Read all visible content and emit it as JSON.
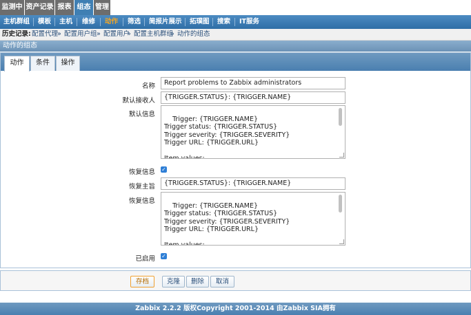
{
  "top_menu": {
    "items": [
      {
        "label": "监测中"
      },
      {
        "label": "资产记录"
      },
      {
        "label": "报表"
      },
      {
        "label": "组态"
      },
      {
        "label": "管理"
      }
    ]
  },
  "sub_menu": {
    "items": [
      {
        "label": "主机群组"
      },
      {
        "label": "模板"
      },
      {
        "label": "主机"
      },
      {
        "label": "维修"
      },
      {
        "label": "动作"
      },
      {
        "label": "筛选"
      },
      {
        "label": "简报片展示"
      },
      {
        "label": "拓璞图"
      },
      {
        "label": "搜索"
      },
      {
        "label": "IT服务"
      }
    ],
    "active": "动作"
  },
  "breadcrumb": {
    "label": "历史记录:",
    "items": [
      "配置代理",
      "配置用户组",
      "配置用户",
      "配置主机群组",
      "动作的组态"
    ],
    "separator": "»"
  },
  "page_title": "动作的组态",
  "tabs": [
    {
      "label": "动作"
    },
    {
      "label": "条件"
    },
    {
      "label": "操作"
    }
  ],
  "form": {
    "name_label": "名称",
    "name_value": "Report problems to Zabbix administrators",
    "default_subject_label": "默认接收人",
    "default_subject_value": "{TRIGGER.STATUS}: {TRIGGER.NAME}",
    "default_message_label": "默认信息",
    "default_message_value": "Trigger: {TRIGGER.NAME}\nTrigger status: {TRIGGER.STATUS}\nTrigger severity: {TRIGGER.SEVERITY}\nTrigger URL: {TRIGGER.URL}\n\nItem values:",
    "recovery_label": "恢复信息",
    "recovery_checked": true,
    "recovery_subject_label": "恢复主旨",
    "recovery_subject_value": "{TRIGGER.STATUS}: {TRIGGER.NAME}",
    "recovery_message_label": "恢复信息",
    "recovery_message_value": "Trigger: {TRIGGER.NAME}\nTrigger status: {TRIGGER.STATUS}\nTrigger severity: {TRIGGER.SEVERITY}\nTrigger URL: {TRIGGER.URL}\n\nItem values:",
    "enabled_label": "已启用",
    "enabled_checked": true
  },
  "buttons": {
    "save": "存档",
    "clone": "克隆",
    "delete": "删除",
    "cancel": "取消"
  },
  "footer": "Zabbix 2.2.2 版权Copyright 2001-2014 由Zabbix SIA拥有",
  "colors": {
    "active_menu": "#f5a623",
    "bar_blue": "#3f7fb3",
    "checkbox": "#2f7fd6"
  }
}
